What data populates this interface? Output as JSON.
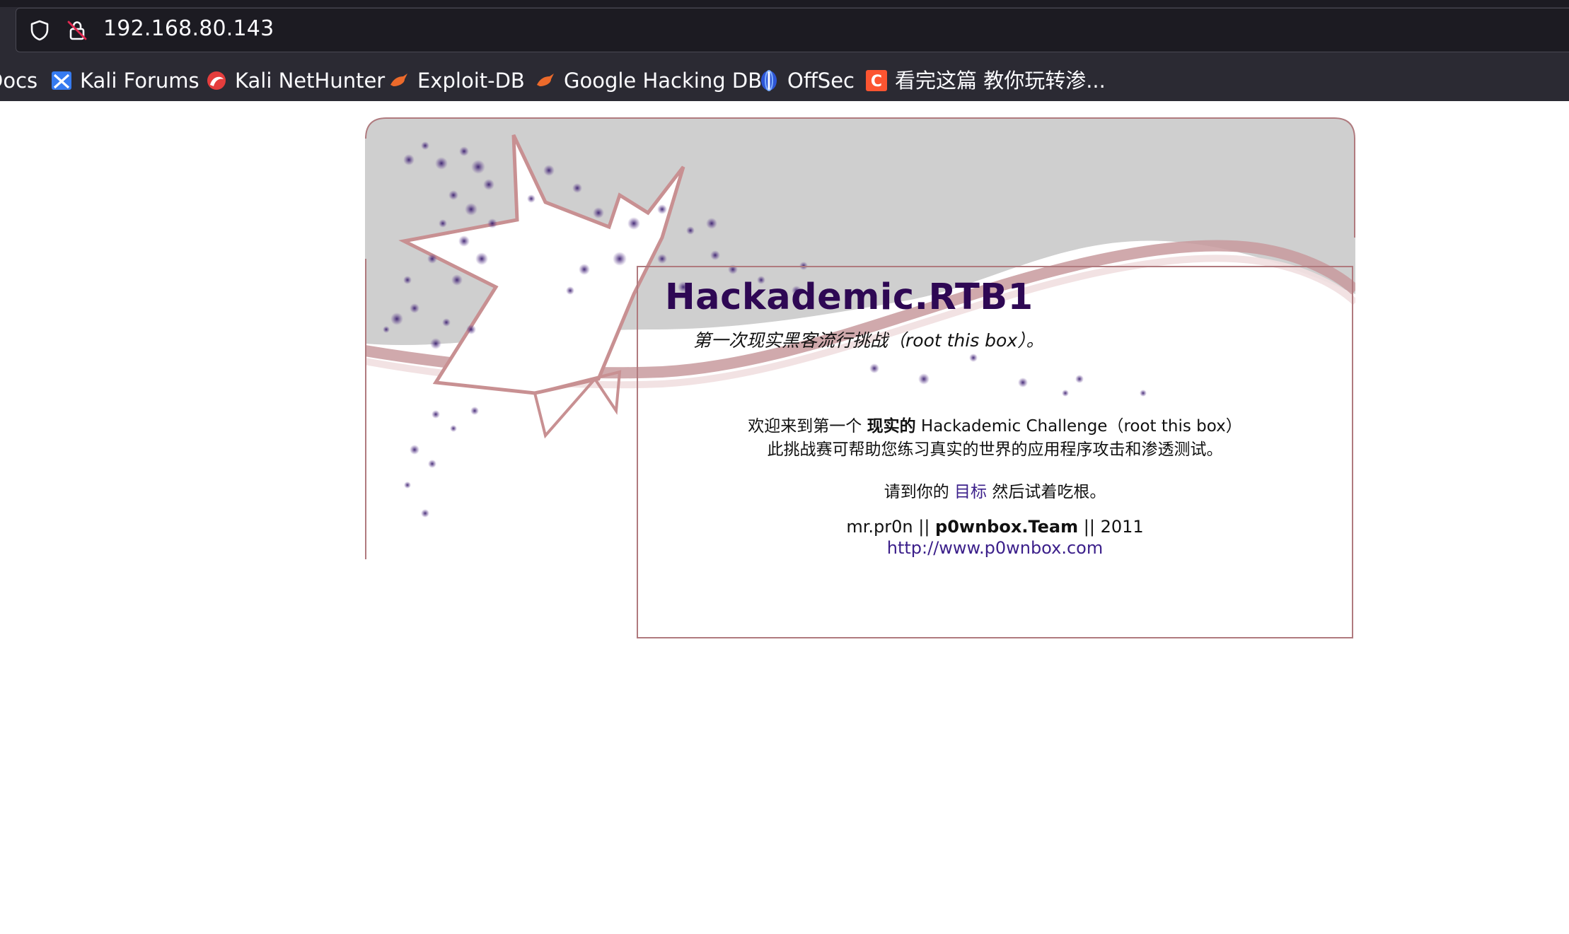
{
  "browser": {
    "url": "192.168.80.143",
    "bookmarks": [
      {
        "label": "Docs",
        "icon": "kali-docs-icon"
      },
      {
        "label": "Kali Forums",
        "icon": "kali-forums-icon"
      },
      {
        "label": "Kali NetHunter",
        "icon": "kali-nethunter-icon"
      },
      {
        "label": "Exploit-DB",
        "icon": "exploit-db-icon"
      },
      {
        "label": "Google Hacking DB",
        "icon": "ghdb-icon"
      },
      {
        "label": "OffSec",
        "icon": "offsec-icon"
      },
      {
        "label": "看完这篇 教你玩转渗...",
        "icon": "csdn-icon"
      }
    ]
  },
  "page": {
    "title": "Hackademic.RTB1",
    "subtitle": "第一次现实黑客流行挑战（root this box）。",
    "welcome_prefix": "欢迎来到第一个",
    "welcome_bold": "现实的",
    "welcome_suffix": "Hackademic Challenge（root this box）",
    "description": "此挑战赛可帮助您练习真实的世界的应用程序攻击和渗透测试。",
    "instruction_prefix": "请到你的",
    "target_link": "目标",
    "instruction_suffix": "然后试着吃根。",
    "credit_author": "mr.pr0n ||",
    "credit_team": "p0wnbox.Team",
    "credit_year": "|| 2011",
    "website_link": "http://www.p0wnbox.com"
  },
  "colors": {
    "title": "#2e0854",
    "link": "#3b1f8a",
    "border": "#b07a7e",
    "chrome_bg": "#2b2a33"
  }
}
